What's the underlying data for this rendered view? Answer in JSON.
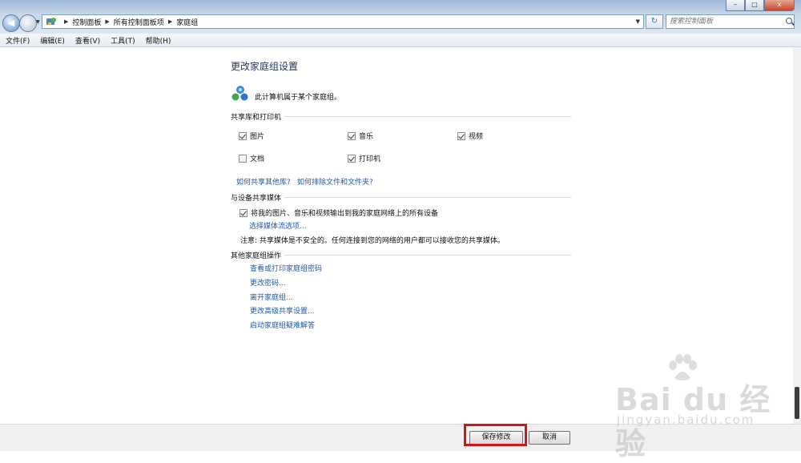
{
  "window": {
    "minimize": "–",
    "maximize": "□",
    "close": "x"
  },
  "address": {
    "crumbs": [
      "控制面板",
      "所有控制面板项",
      "家庭组"
    ]
  },
  "search": {
    "placeholder": "搜索控制面板"
  },
  "menu": [
    "文件(F)",
    "编辑(E)",
    "查看(V)",
    "工具(T)",
    "帮助(H)"
  ],
  "page": {
    "title": "更改家庭组设置",
    "membership": "此计算机属于某个家庭组。",
    "share_section": "共享库和打印机",
    "libraries": [
      {
        "label": "图片",
        "checked": true
      },
      {
        "label": "音乐",
        "checked": true
      },
      {
        "label": "视频",
        "checked": true
      },
      {
        "label": "文档",
        "checked": false
      },
      {
        "label": "打印机",
        "checked": true
      }
    ],
    "links_share": [
      "如何共享其他库?",
      "如何排除文件和文件夹?"
    ],
    "media_section": "与设备共享媒体",
    "media_checkbox": {
      "label": "将我的图片、音乐和视频输出到我的家庭网络上的所有设备",
      "checked": true
    },
    "media_link": "选择媒体流选项...",
    "note": "注意: 共享媒体是不安全的。任何连接到您的网络的用户都可以接收您的共享媒体。",
    "other_section": "其他家庭组操作",
    "other_links": [
      "查看或打印家庭组密码",
      "更改密码...",
      "离开家庭组...",
      "更改高级共享设置...",
      "启动家庭组疑难解答"
    ]
  },
  "footer": {
    "save": "保存修改",
    "cancel": "取消"
  },
  "watermark": {
    "main": "Bai du 经验",
    "sub": "jingyan.baidu.com"
  },
  "colors": {
    "link": "#1f5aa8",
    "title": "#1e395b",
    "highlight": "#d0161b"
  }
}
